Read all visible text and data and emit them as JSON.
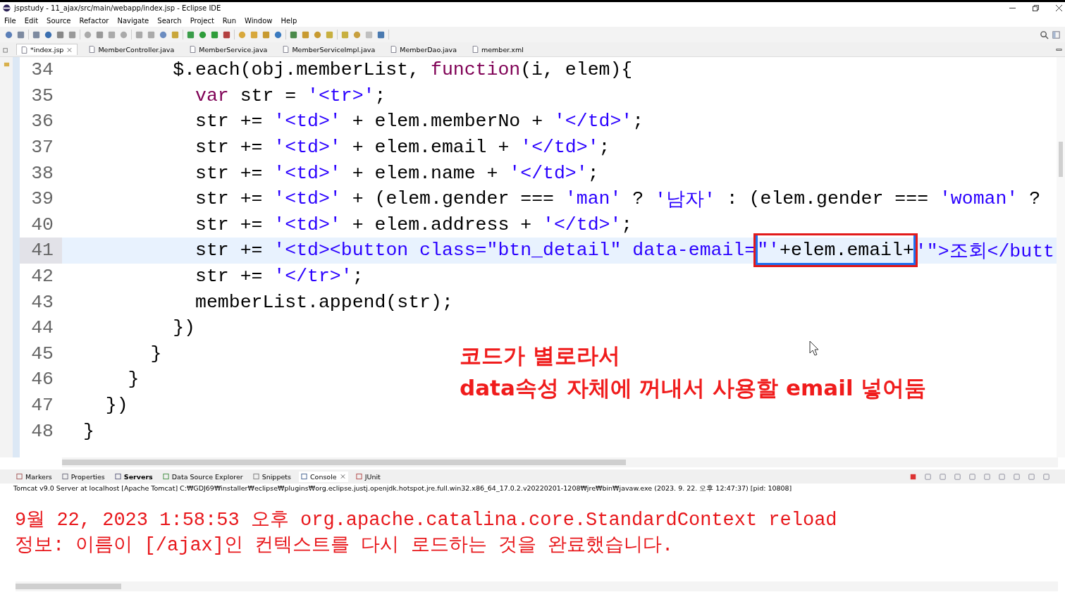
{
  "window": {
    "title": "jspstudy - 11_ajax/src/main/webapp/index.jsp - Eclipse IDE"
  },
  "menu": [
    "File",
    "Edit",
    "Source",
    "Refactor",
    "Navigate",
    "Search",
    "Project",
    "Run",
    "Window",
    "Help"
  ],
  "editor_tabs": [
    {
      "label": "*index.jsp",
      "selected": true,
      "closable": true
    },
    {
      "label": "MemberController.java",
      "selected": false,
      "closable": false
    },
    {
      "label": "MemberService.java",
      "selected": false,
      "closable": false
    },
    {
      "label": "MemberServiceImpl.java",
      "selected": false,
      "closable": false
    },
    {
      "label": "MemberDao.java",
      "selected": false,
      "closable": false
    },
    {
      "label": "member.xml",
      "selected": false,
      "closable": false
    }
  ],
  "code": [
    {
      "number": "34",
      "current": false,
      "segments": [
        {
          "kind": "plain",
          "text": "        $.each(obj.memberList, "
        },
        {
          "kind": "keyword",
          "text": "function"
        },
        {
          "kind": "plain",
          "text": "(i, elem){"
        }
      ]
    },
    {
      "number": "35",
      "current": false,
      "segments": [
        {
          "kind": "keyword",
          "text": "          var"
        },
        {
          "kind": "plain",
          "text": " str = "
        },
        {
          "kind": "string",
          "text": "'<tr>'"
        },
        {
          "kind": "plain",
          "text": ";"
        }
      ]
    },
    {
      "number": "36",
      "current": false,
      "segments": [
        {
          "kind": "plain",
          "text": "          str += "
        },
        {
          "kind": "string",
          "text": "'<td>'"
        },
        {
          "kind": "plain",
          "text": " + elem.memberNo + "
        },
        {
          "kind": "string",
          "text": "'</td>'"
        },
        {
          "kind": "plain",
          "text": ";"
        }
      ]
    },
    {
      "number": "37",
      "current": false,
      "segments": [
        {
          "kind": "plain",
          "text": "          str += "
        },
        {
          "kind": "string",
          "text": "'<td>'"
        },
        {
          "kind": "plain",
          "text": " + elem.email + "
        },
        {
          "kind": "string",
          "text": "'</td>'"
        },
        {
          "kind": "plain",
          "text": ";"
        }
      ]
    },
    {
      "number": "38",
      "current": false,
      "segments": [
        {
          "kind": "plain",
          "text": "          str += "
        },
        {
          "kind": "string",
          "text": "'<td>'"
        },
        {
          "kind": "plain",
          "text": " + elem.name + "
        },
        {
          "kind": "string",
          "text": "'</td>'"
        },
        {
          "kind": "plain",
          "text": ";"
        }
      ]
    },
    {
      "number": "39",
      "current": false,
      "segments": [
        {
          "kind": "plain",
          "text": "          str += "
        },
        {
          "kind": "string",
          "text": "'<td>'"
        },
        {
          "kind": "plain",
          "text": " + (elem.gender === "
        },
        {
          "kind": "string",
          "text": "'man'"
        },
        {
          "kind": "plain",
          "text": " ? "
        },
        {
          "kind": "string",
          "text": "'남자'"
        },
        {
          "kind": "plain",
          "text": " : (elem.gender === "
        },
        {
          "kind": "string",
          "text": "'woman'"
        },
        {
          "kind": "plain",
          "text": " ?"
        }
      ]
    },
    {
      "number": "40",
      "current": false,
      "segments": [
        {
          "kind": "plain",
          "text": "          str += "
        },
        {
          "kind": "string",
          "text": "'<td>'"
        },
        {
          "kind": "plain",
          "text": " + elem.address + "
        },
        {
          "kind": "string",
          "text": "'</td>'"
        },
        {
          "kind": "plain",
          "text": ";"
        }
      ]
    },
    {
      "number": "41",
      "current": true,
      "segments": [
        {
          "kind": "plain",
          "text": "          str += "
        },
        {
          "kind": "string",
          "text": "'<td><button class=\"btn_detail\" data-email="
        },
        {
          "kind": "outlined",
          "children": [
            {
              "kind": "string",
              "text": "\"'"
            },
            {
              "kind": "plain",
              "text": "+elem.email+"
            }
          ]
        },
        {
          "kind": "string",
          "text": "'\">조회</butt"
        }
      ]
    },
    {
      "number": "42",
      "current": false,
      "segments": [
        {
          "kind": "plain",
          "text": "          str += "
        },
        {
          "kind": "string",
          "text": "'</tr>'"
        },
        {
          "kind": "plain",
          "text": ";"
        }
      ]
    },
    {
      "number": "43",
      "current": false,
      "segments": [
        {
          "kind": "plain",
          "text": "          memberList.append(str);"
        }
      ]
    },
    {
      "number": "44",
      "current": false,
      "segments": [
        {
          "kind": "plain",
          "text": "        })"
        }
      ]
    },
    {
      "number": "45",
      "current": false,
      "segments": [
        {
          "kind": "plain",
          "text": "      }"
        }
      ]
    },
    {
      "number": "46",
      "current": false,
      "segments": [
        {
          "kind": "plain",
          "text": "    }"
        }
      ]
    },
    {
      "number": "47",
      "current": false,
      "segments": [
        {
          "kind": "plain",
          "text": "  })"
        }
      ]
    },
    {
      "number": "48",
      "current": false,
      "segments": [
        {
          "kind": "plain",
          "text": "}"
        }
      ]
    }
  ],
  "annotation": [
    "코드가 별로라서",
    "data속성 자체에 꺼내서 사용할 email 넣어둠"
  ],
  "panel_tabs": [
    {
      "label": "Markers",
      "selected": false,
      "bold": false
    },
    {
      "label": "Properties",
      "selected": false,
      "bold": false
    },
    {
      "label": "Servers",
      "selected": false,
      "bold": true
    },
    {
      "label": "Data Source Explorer",
      "selected": false,
      "bold": false
    },
    {
      "label": "Snippets",
      "selected": false,
      "bold": false
    },
    {
      "label": "Console",
      "selected": true,
      "bold": false
    },
    {
      "label": "JUnit",
      "selected": false,
      "bold": false
    }
  ],
  "console": {
    "header": "Tomcat v9.0 Server at localhost [Apache Tomcat] C:₩GDJ69₩installer₩eclipse₩plugins₩org.eclipse.justj.openjdk.hotspot.jre.full.win32.x86_64_17.0.2.v20220201-1208₩jre₩bin₩javaw.exe  (2023. 9. 22. 오후 12:47:37) [pid: 10808]",
    "lines": [
      "9월 22, 2023 1:58:53 오후 org.apache.catalina.core.StandardContext reload",
      "정보: 이름이 [/ajax]인 컨텍스트를 다시 로드하는 것을 완료했습니다."
    ]
  }
}
